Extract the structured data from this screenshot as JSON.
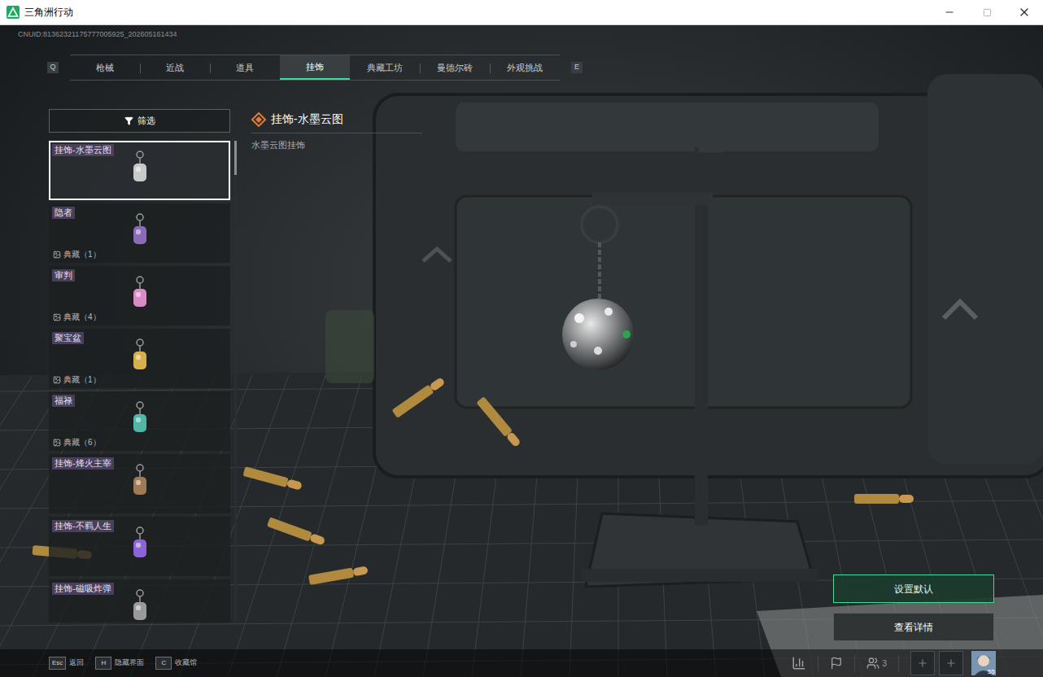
{
  "window": {
    "title": "三角洲行动"
  },
  "uid": "CNUID:81362321175777005925_202605161434",
  "tab_keys": {
    "prev": "Q",
    "next": "E"
  },
  "tabs": [
    {
      "label": "枪械",
      "selected": false
    },
    {
      "label": "近战",
      "selected": false
    },
    {
      "label": "道具",
      "selected": false
    },
    {
      "label": "挂饰",
      "selected": true
    },
    {
      "label": "典藏工坊",
      "selected": false
    },
    {
      "label": "曼德尔砖",
      "selected": false
    },
    {
      "label": "外观挑战",
      "selected": false
    }
  ],
  "filter": {
    "label": "筛选"
  },
  "items": [
    {
      "name": "挂饰-水墨云图",
      "badge": null,
      "selected": true,
      "color": "#c9c9c9"
    },
    {
      "name": "隐者",
      "badge": "典藏（1）",
      "selected": false,
      "color": "#8a6bb8"
    },
    {
      "name": "审判",
      "badge": "典藏（4）",
      "selected": false,
      "color": "#d98bc4"
    },
    {
      "name": "聚宝盆",
      "badge": "典藏（1）",
      "selected": false,
      "color": "#d6b04a"
    },
    {
      "name": "福禄",
      "badge": "典藏（6）",
      "selected": false,
      "color": "#4fb6a8"
    },
    {
      "name": "挂饰-烽火主宰",
      "badge": null,
      "selected": false,
      "color": "#a07a55"
    },
    {
      "name": "挂饰-不羁人生",
      "badge": null,
      "selected": false,
      "color": "#8d63d8"
    },
    {
      "name": "挂饰-磁吸炸弹",
      "badge": null,
      "selected": false,
      "color": "#9a9a9a"
    }
  ],
  "detail": {
    "title": "挂饰-水墨云图",
    "description": "水墨云图挂饰"
  },
  "actions": [
    {
      "label": "设置默认",
      "selected": true
    },
    {
      "label": "查看详情",
      "selected": false
    }
  ],
  "hints": [
    {
      "key": "Esc",
      "label": "返回"
    },
    {
      "key": "H",
      "label": "隐藏界面"
    },
    {
      "key": "C",
      "label": "收藏馆"
    }
  ],
  "status": {
    "team_count": "3",
    "avatar_level": "55"
  }
}
